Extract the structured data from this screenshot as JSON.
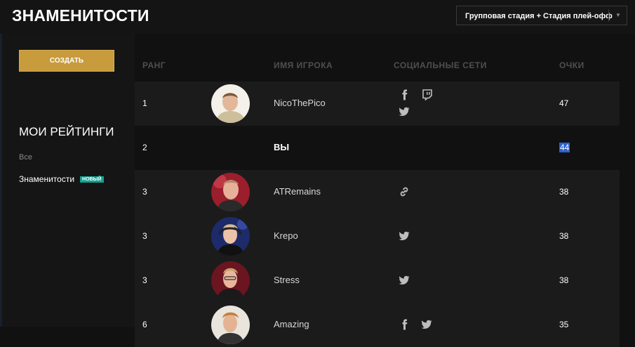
{
  "header": {
    "title": "ЗНАМЕНИТОСТИ",
    "stage_select": {
      "value": "Групповая стадия + Стадия плей-офф",
      "arrow": "▼"
    }
  },
  "sidebar": {
    "create_label": "СОЗДАТЬ",
    "section_title": "МОИ РЕЙТИНГИ",
    "filters": [
      {
        "label": "Все",
        "active": false
      },
      {
        "label": "Знаменитости",
        "active": true,
        "badge": "НОВЫЙ"
      }
    ]
  },
  "table": {
    "columns": [
      "РАНГ",
      "ИМЯ ИГРОКА",
      "СОЦИАЛЬНЫЕ СЕТИ",
      "ОЧКИ"
    ],
    "rows": [
      {
        "rank": "1",
        "name": "NicoThePico",
        "points": "47",
        "socials": [
          "facebook-icon",
          "twitch-icon",
          "twitter-icon"
        ]
      },
      {
        "rank": "2",
        "name": "ВЫ",
        "points": "44",
        "socials": []
      },
      {
        "rank": "3",
        "name": "ATRemains",
        "points": "38",
        "socials": [
          "link-icon"
        ]
      },
      {
        "rank": "3",
        "name": "Krepo",
        "points": "38",
        "socials": [
          "twitter-icon"
        ]
      },
      {
        "rank": "3",
        "name": "Stress",
        "points": "38",
        "socials": [
          "twitter-icon"
        ]
      },
      {
        "rank": "6",
        "name": "Amazing",
        "points": "35",
        "socials": [
          "facebook-icon",
          "twitter-icon"
        ]
      }
    ]
  },
  "colors": {
    "accent_gold": "#c89b3c",
    "badge_teal": "#0fa391",
    "selection_blue": "#2b62cf"
  }
}
